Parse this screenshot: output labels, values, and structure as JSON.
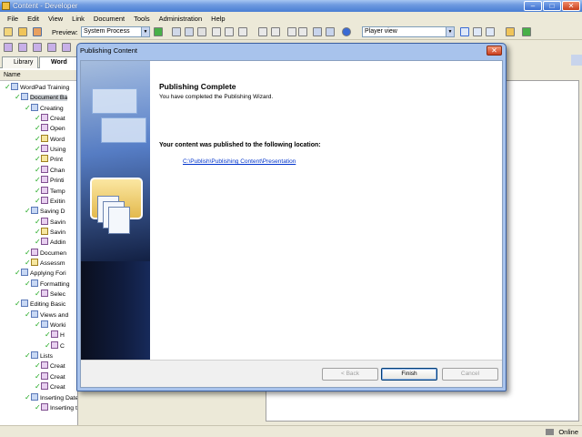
{
  "window": {
    "title": "Content - Developer"
  },
  "menu": [
    "File",
    "Edit",
    "View",
    "Link",
    "Document",
    "Tools",
    "Administration",
    "Help"
  ],
  "toolbar": {
    "preview_label": "Preview:",
    "preview_value": "System Process",
    "view_value": "Player view"
  },
  "left_panel": {
    "tabs": [
      "Library",
      "Word"
    ],
    "column_header": "Name",
    "tree": [
      {
        "label": "WordPad Training",
        "icon": "book"
      },
      {
        "label": "Document Ba",
        "icon": "book"
      },
      {
        "label": "Creating",
        "icon": "book"
      },
      {
        "label": "Creat",
        "icon": "sim"
      },
      {
        "label": "Open",
        "icon": "sim"
      },
      {
        "label": "Word",
        "icon": "q"
      },
      {
        "label": "Using",
        "icon": "sim"
      },
      {
        "label": "Print",
        "icon": "q"
      },
      {
        "label": "Chan",
        "icon": "sim"
      },
      {
        "label": "Printi",
        "icon": "sim"
      },
      {
        "label": "Temp",
        "icon": "sim"
      },
      {
        "label": "Exitin",
        "icon": "sim"
      },
      {
        "label": "Saving D",
        "icon": "book"
      },
      {
        "label": "Savin",
        "icon": "sim"
      },
      {
        "label": "Savin",
        "icon": "q"
      },
      {
        "label": "Addin",
        "icon": "sim"
      },
      {
        "label": "Documen",
        "icon": "sim"
      },
      {
        "label": "Assessm",
        "icon": "q"
      },
      {
        "label": "Applying Fori",
        "icon": "book"
      },
      {
        "label": "Formatting",
        "icon": "book"
      },
      {
        "label": "Selec",
        "icon": "sim"
      },
      {
        "label": "Editing Basic",
        "icon": "book"
      },
      {
        "label": "Views and",
        "icon": "book"
      },
      {
        "label": "Worki",
        "icon": "book"
      },
      {
        "label": "H",
        "icon": "sim"
      },
      {
        "label": "C",
        "icon": "sim"
      },
      {
        "label": "Lists",
        "icon": "book"
      },
      {
        "label": "Creat",
        "icon": "sim"
      },
      {
        "label": "Creat",
        "icon": "sim"
      },
      {
        "label": "Creat",
        "icon": "sim"
      },
      {
        "label": "Inserting Dates and Objects",
        "icon": "book"
      },
      {
        "label": "Inserting the Date",
        "icon": "sim"
      }
    ]
  },
  "dialog": {
    "title": "Publishing Content",
    "heading": "Publishing Complete",
    "subheading": "You have completed the Publishing Wizard.",
    "message": "Your content was published to the following location:",
    "location_link": "C:\\Publish\\Publishing Content\\Presentation",
    "buttons": {
      "back": "< Back",
      "finish": "Finish",
      "cancel": "Cancel"
    }
  },
  "status": {
    "online": "Online"
  }
}
